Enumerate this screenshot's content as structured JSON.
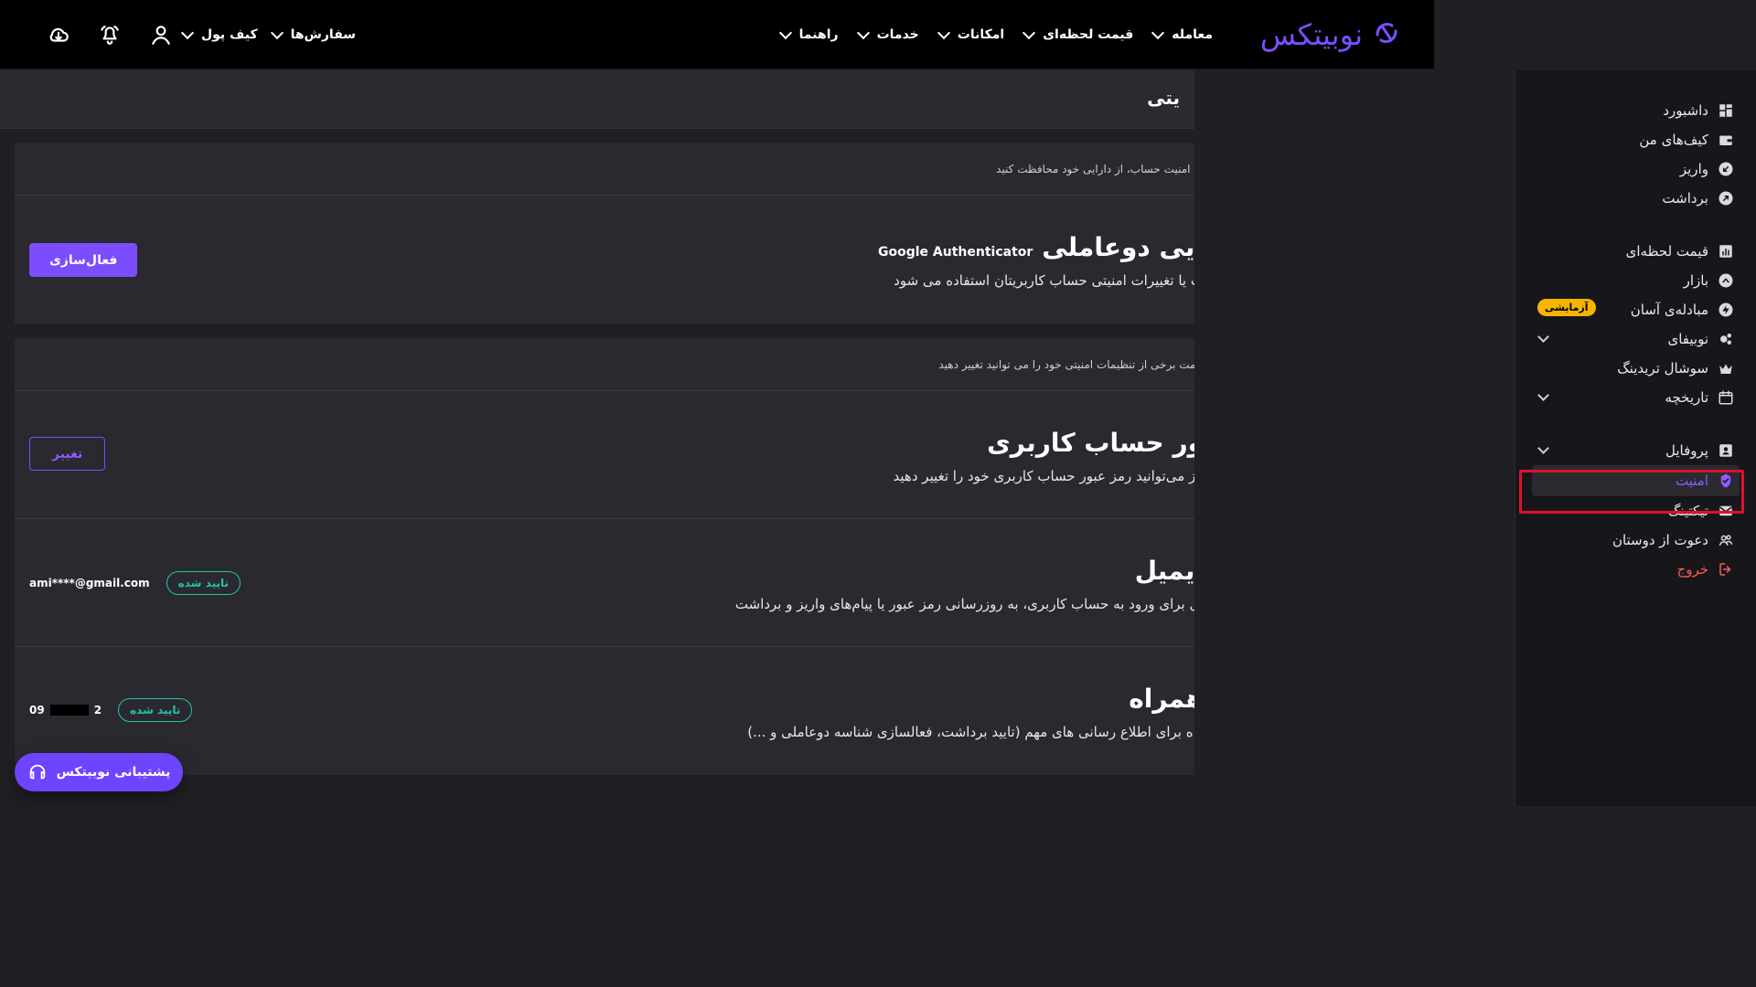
{
  "brand": {
    "name": "نوبیتکس",
    "accent": "#7c4dff"
  },
  "top_nav": [
    {
      "label": "معامله"
    },
    {
      "label": "قیمت لحظه‌ای"
    },
    {
      "label": "امکانات"
    },
    {
      "label": "خدمات"
    },
    {
      "label": "راهنما"
    }
  ],
  "top_left_links": [
    {
      "label": "سفارش‌ها"
    },
    {
      "label": "کیف پول"
    }
  ],
  "top_icons": {
    "download": "download-icon",
    "bell": "bell-icon",
    "user": "user-icon"
  },
  "breadcrumb": {
    "title": "یتی"
  },
  "cards": [
    {
      "header": "ای امنیت حساب، از دارایی خود محافظت کنید",
      "rows": [
        {
          "title": "ایی دوعاملی",
          "tag": "Google Authenticator",
          "desc": "ت یا تغییرات امنیتی حساب کاربریتان استفاده می شود",
          "action": "فعال‌سازی"
        }
      ]
    },
    {
      "header": "سمت برخی از تنظیمات امنیتی خود را می توانید تغییر دهید",
      "rows": [
        {
          "title": "ور حساب کاربری",
          "desc": "یاز می‌توانید رمز عبور حساب کاربری خود را تغییر دهید",
          "action": "تغییر"
        },
        {
          "title": "ایمیل",
          "desc": "یل برای ورود به حساب کاربری، به روزرسانی رمز عبور یا پیام‌های واریز و برداشت",
          "badge": "تایید شده",
          "value": "ami****@gmail.com"
        },
        {
          "title": "همراه",
          "desc": "راه برای اطلاع رسانی های مهم (تایید برداشت، فعالسازی شناسه دوعاملی و ...)",
          "badge": "تایید شده",
          "phone_prefix": "09",
          "phone_suffix": "2"
        }
      ]
    }
  ],
  "sidebar": {
    "items": [
      {
        "label": "داشبورد",
        "icon": "dashboard-icon"
      },
      {
        "label": "کیف‌های من",
        "icon": "wallet-icon"
      },
      {
        "label": "واریز",
        "icon": "deposit-icon"
      },
      {
        "label": "برداشت",
        "icon": "withdraw-icon"
      },
      {
        "label": "قیمت لحظه‌ای",
        "icon": "chart-icon"
      },
      {
        "label": "بازار",
        "icon": "market-icon"
      },
      {
        "label": "مبادله‌ی آسان",
        "icon": "lightning-icon",
        "pill": "آزمایشی"
      },
      {
        "label": "نوبیفای",
        "icon": "nobify-icon"
      },
      {
        "label": "سوشال تریدینگ",
        "icon": "crown-icon"
      },
      {
        "label": "تاریخچه",
        "icon": "calendar-icon"
      },
      {
        "label": "پروفایل",
        "icon": "profile-icon"
      },
      {
        "label": "امنیت",
        "icon": "shield-check-icon"
      },
      {
        "label": "تیکتینگ",
        "icon": "mail-icon"
      },
      {
        "label": "دعوت از دوستان",
        "icon": "friends-icon"
      },
      {
        "label": "خروج",
        "icon": "logout-icon"
      }
    ],
    "active_index": 11
  },
  "support": {
    "label": "پشتیبانی نوبیتکس",
    "icon": "headset-icon"
  },
  "colors": {
    "background": "#1f1f24",
    "panel": "#29292f",
    "sidebar": "#17171b",
    "accent": "#7c4dff",
    "verified": "#25c3a6",
    "danger": "#ff5a5a",
    "highlight": "#e0112b",
    "pill": "#f7b500"
  }
}
